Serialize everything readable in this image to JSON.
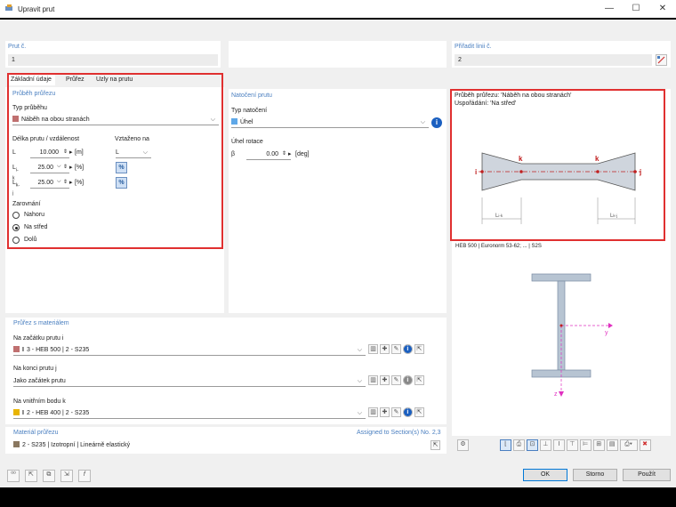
{
  "window": {
    "title": "Upravit prut",
    "controls": {
      "minimize": "—",
      "maximize": "☐",
      "close": "✕"
    }
  },
  "member": {
    "label": "Prut č.",
    "value": "1"
  },
  "assign_line": {
    "label": "Přiřadit linii č.",
    "value": "2"
  },
  "tabs": [
    {
      "label": "Základní údaje"
    },
    {
      "label": "Průřez"
    },
    {
      "label": "Uzly na prutu"
    }
  ],
  "profile": {
    "section_title": "Průběh průřezu",
    "type_label": "Typ průběhu",
    "type_value": "Náběh na obou stranách",
    "type_color": "#c07070",
    "length_header": "Délka prutu / vzdálenost",
    "related_header": "Vztaženo na",
    "rows": [
      {
        "sym": "L",
        "sub": "",
        "value": "10.000",
        "unit": "[m]",
        "related": "L"
      },
      {
        "sym": "L",
        "sub": "i-k",
        "value": "25.00",
        "unit": "[%]"
      },
      {
        "sym": "L",
        "sub": "k-j",
        "value": "25.00",
        "unit": "[%]"
      }
    ],
    "alignment_label": "Zarovnání",
    "alignment_options": [
      {
        "label": "Nahoru",
        "selected": false
      },
      {
        "label": "Na střed",
        "selected": true
      },
      {
        "label": "Dolů",
        "selected": false
      }
    ]
  },
  "rotation": {
    "section_title": "Natočení prutu",
    "type_label": "Typ natočení",
    "type_value": "Úhel",
    "type_color": "#5fa8e8",
    "angle_label": "Úhel rotace",
    "beta_sym": "β",
    "beta_value": "0.00",
    "beta_unit": "[deg]"
  },
  "preview": {
    "line1": "Průběh průřezu: 'Náběh na obou stranách'",
    "line2": "Uspořádání: 'Na střed'",
    "node_i": "i",
    "node_j": "j",
    "node_k1": "k",
    "node_k2": "k",
    "dim_left": "L",
    "dim_left_sub": "i-k",
    "dim_right": "L",
    "dim_right_sub": "k-j"
  },
  "section_info": "HEB 500 | Euronorm 53-62; ... | S2S",
  "axes": {
    "y": "y",
    "z": "z"
  },
  "cross_sections": {
    "title": "Průřez s materiálem",
    "start_label": "Na začátku prutu i",
    "start_value": "3 - HEB 500 | 2 - S235",
    "start_color": "#c07070",
    "end_label": "Na konci prutu j",
    "end_value": "Jako začátek prutu",
    "inner_label": "Na vnitřním bodu k",
    "inner_value": "2 - HEB 400 | 2 - S235",
    "inner_color": "#e8b400"
  },
  "material": {
    "title": "Materiál průřezu",
    "assigned": "Assigned to Section(s) No. 2,3",
    "value": "2 - S235 | Izotropní | Lineárně elastický",
    "color": "#8a7860"
  },
  "buttons": {
    "ok": "OK",
    "cancel": "Storno",
    "apply": "Použít"
  },
  "accent": "#e03030"
}
